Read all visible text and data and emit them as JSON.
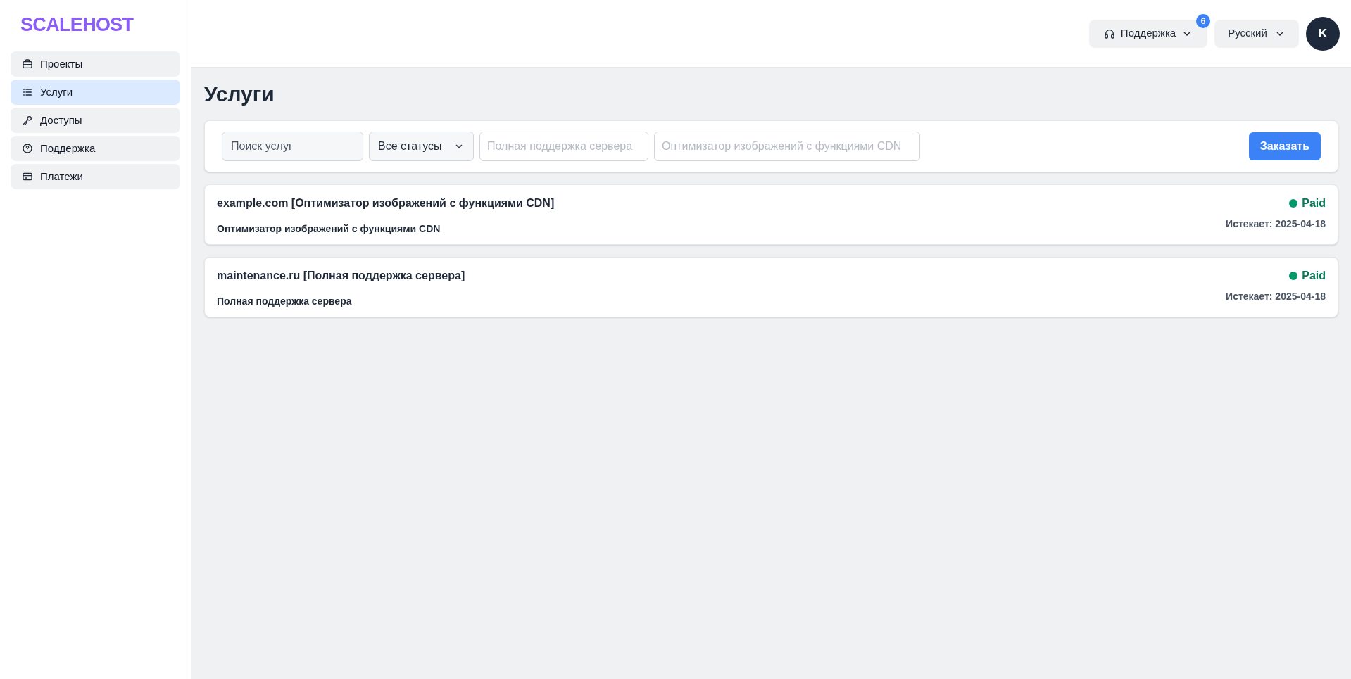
{
  "logo": "SCALEHOST",
  "sidebar": {
    "items": [
      {
        "label": "Проекты",
        "selected": false
      },
      {
        "label": "Услуги",
        "selected": true
      },
      {
        "label": "Доступы",
        "selected": false
      },
      {
        "label": "Поддержка",
        "selected": false
      },
      {
        "label": "Платежи",
        "selected": false
      }
    ]
  },
  "header": {
    "support_button": {
      "label": "Поддержка",
      "badge": "6"
    },
    "language": "Русский",
    "avatar": "K"
  },
  "page_title": "Услуги",
  "filters": {
    "search": {
      "placeholder": "Поиск услуг"
    },
    "status_select": "Все статусы",
    "fields": [
      {
        "placeholder": "Полная поддержка сервера"
      },
      {
        "placeholder": "Оптимизатор изображений с функциями CDN"
      }
    ],
    "order_button": "Заказать"
  },
  "services": [
    {
      "title": "example.com [Оптимизатор изображений с функциями CDN]",
      "subtitle": "Оптимизатор изображений с функциями CDN",
      "status": "Paid",
      "expires": "Истекает: 2025-04-18"
    },
    {
      "title": "maintenance.ru [Полная поддержка сервера]",
      "subtitle": "Полная поддержка сервера",
      "status": "Paid",
      "expires": "Истекает: 2025-04-18"
    }
  ]
}
